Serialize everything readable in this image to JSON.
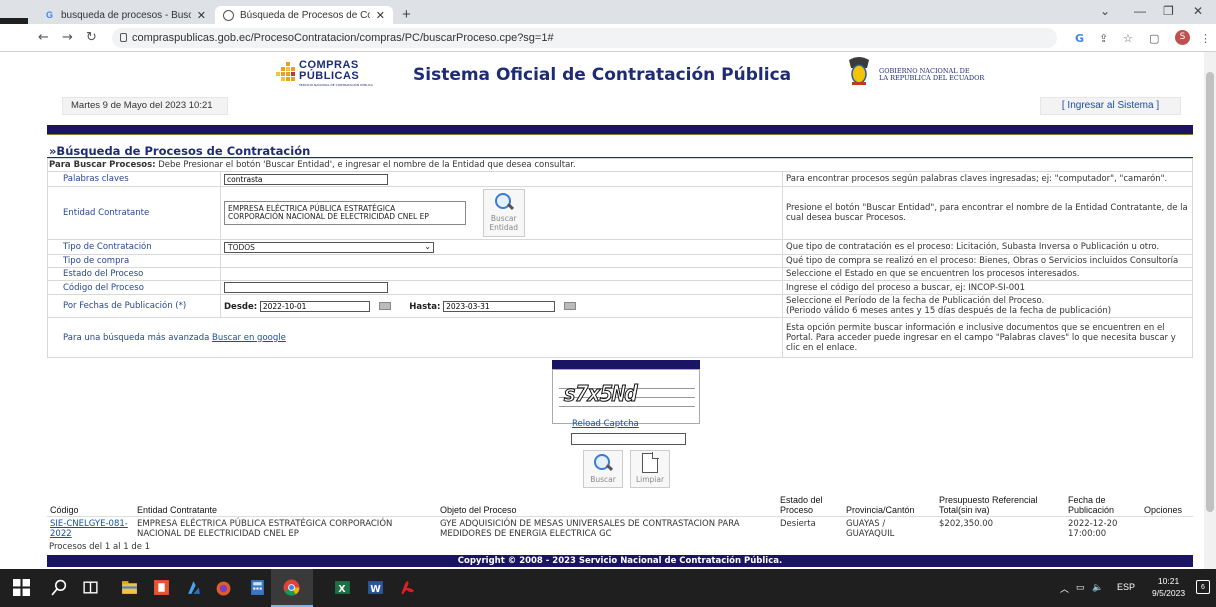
{
  "browser": {
    "tabs": [
      {
        "title": "busqueda de procesos - Buscar c",
        "active": false
      },
      {
        "title": "Búsqueda de Procesos de Contra",
        "active": true
      }
    ],
    "url": "compraspublicas.gob.ec/ProcesoContratacion/compras/PC/buscarProceso.cpe?sg=1#",
    "profile_initial": "S"
  },
  "header": {
    "logo_line1": "COMPRAS",
    "logo_line2": "PÚBLICAS",
    "logo_line3": "SERVICIO NACIONAL DE CONTRATACIÓN PÚBLICA",
    "site_title": "Sistema Oficial de Contratación Pública",
    "gov_line1": "GOBIERNO NACIONAL DE",
    "gov_line2": "LA REPUBLICA DEL ECUADOR",
    "date": "Martes 9 de Mayo del 2023 10:21",
    "login": "[ Ingresar al Sistema ]"
  },
  "search": {
    "section_title": "»Búsqueda de Procesos de Contratación",
    "instructions_bold": "Para Buscar Procesos:",
    "instructions": " Debe Presionar el botón 'Buscar Entidad', e ingresar el nombre de la Entidad que desea consultar.",
    "keywords_label": "Palabras claves",
    "keywords_value": "contrasta",
    "keywords_help": "Para encontrar procesos según palabras claves ingresadas; ej: \"computador\", \"camarón\".",
    "entity_label": "Entidad Contratante",
    "entity_value_line1": "EMPRESA ELÉCTRICA PÚBLICA ESTRATÉGICA",
    "entity_value_line2": "CORPORACIÓN NACIONAL DE ELECTRICIDAD CNEL EP",
    "entity_button_line1": "Buscar",
    "entity_button_line2": "Entidad",
    "entity_help": "Presione el botón \"Buscar Entidad\", para encontrar el nombre de la Entidad Contratante, de la cual desea buscar Procesos.",
    "contract_type_label": "Tipo de Contratación",
    "contract_type_value": "TODOS",
    "contract_type_help": "Que tipo de contratación es el proceso: Licitación, Subasta Inversa o Publicación u otro.",
    "purchase_type_label": "Tipo de compra",
    "purchase_type_help": "Qué tipo de compra se realizó en el proceso: Bienes, Obras o Servicios incluidos Consultoría",
    "state_label": "Estado del Proceso",
    "state_help": "Seleccione el Estado en que se encuentren los procesos interesados.",
    "code_label": "Código del Proceso",
    "code_value": "",
    "code_help": "Ingrese el código del proceso a buscar, ej: INCOP-SI-001",
    "dates_label": "Por Fechas de Publicación (*)",
    "from_label": "Desde:",
    "from_value": "2022-10-01",
    "to_label": "Hasta:",
    "to_value": "2023-03-31",
    "dates_help_line1": "Seleccione el Período de la fecha de Publicación del Proceso.",
    "dates_help_line2": "(Periodo válido 6 meses antes y 15 días después de la fecha de publicación)",
    "advanced_label": "Para una búsqueda más avanzada",
    "advanced_link": "Buscar en google",
    "advanced_help": "Esta opción permite buscar información e inclusive documentos que se encuentren en el Portal. Para acceder puede ingresar en el campo \"Palabras claves\" lo que necesita buscar y clic en el enlace."
  },
  "captcha": {
    "image_text": "s7x5Nd",
    "reload": "Reload Captcha",
    "value": ""
  },
  "actions": {
    "search": "Buscar",
    "clear": "Limpiar"
  },
  "results": {
    "columns": [
      "Código",
      "Entidad Contratante",
      "Objeto del Proceso",
      "Estado del Proceso",
      "Provincia/Cantón",
      "Presupuesto Referencial Total(sin iva)",
      "Fecha de Publicación",
      "Opciones"
    ],
    "rows": [
      {
        "code": "SIE-CNELGYE-081-2022",
        "entity": "EMPRESA ELÉCTRICA PÚBLICA ESTRATÉGICA CORPORACIÓN NACIONAL DE ELECTRICIDAD CNEL EP",
        "object": "GYE ADQUISICIÓN DE MESAS UNIVERSALES DE CONTRASTACION PARA MEDIDORES DE ENERGIA ELECTRICA GC",
        "state": "Desierta",
        "province": "GUAYAS / GUAYAQUIL",
        "budget": "$202,350.00",
        "date": "2022-12-20 17:00:00",
        "options": ""
      }
    ],
    "count": "Procesos del 1 al 1 de 1"
  },
  "footer": "Copyright © 2008 - 2023 Servicio Nacional de Contratación Pública.",
  "taskbar": {
    "language": "ESP",
    "time": "10:21",
    "date": "9/5/2023",
    "notifications": "6"
  },
  "colors": {
    "brand_navy": "#1b1464",
    "title_blue": "#1d2c74",
    "label_blue": "#24488f",
    "link_blue": "#1a4ea0"
  }
}
